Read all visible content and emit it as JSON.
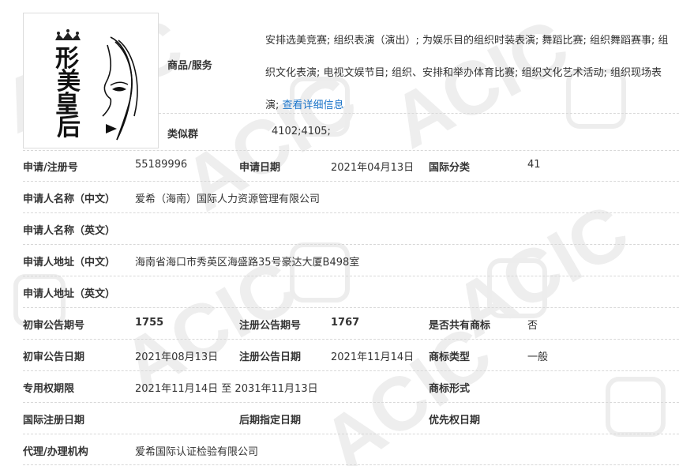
{
  "logo": {
    "text": "形美皇后",
    "chars": [
      "形",
      "美",
      "皇",
      "后"
    ],
    "icon": "crown-icon"
  },
  "goods": {
    "label": "商品/服务",
    "text": "安排选美竞赛; 组织表演（演出）; 为娱乐目的组织时装表演; 舞蹈比赛; 组织舞蹈赛事; 组织文化表演; 电视文娱节目; 组织、安排和举办体育比赛; 组织文化艺术活动; 组织现场表演;",
    "link": "查看详细信息"
  },
  "similar": {
    "label": "类似群",
    "value": "4102;4105;"
  },
  "row1": {
    "reg_no_label": "申请/注册号",
    "reg_no": "55189996",
    "app_date_label": "申请日期",
    "app_date": "2021年04月13日",
    "intl_class_label": "国际分类",
    "intl_class": "41"
  },
  "applicant_cn": {
    "label": "申请人名称（中文）",
    "value": "爱希（海南）国际人力资源管理有限公司"
  },
  "applicant_en": {
    "label": "申请人名称（英文）",
    "value": ""
  },
  "address_cn": {
    "label": "申请人地址（中文）",
    "value": "海南省海口市秀英区海盛路35号豪达大厦B498室"
  },
  "address_en": {
    "label": "申请人地址（英文）",
    "value": ""
  },
  "row_pub": {
    "prelim_no_label": "初审公告期号",
    "prelim_no": "1755",
    "reg_pub_no_label": "注册公告期号",
    "reg_pub_no": "1767",
    "shared_label": "是否共有商标",
    "shared": "否"
  },
  "row_pub_date": {
    "prelim_date_label": "初审公告日期",
    "prelim_date": "2021年08月13日",
    "reg_pub_date_label": "注册公告日期",
    "reg_pub_date": "2021年11月14日",
    "type_label": "商标类型",
    "type": "一般"
  },
  "row_term": {
    "term_label": "专用权期限",
    "term": "2021年11月14日 至 2031年11月13日",
    "form_label": "商标形式",
    "form": ""
  },
  "row_intl": {
    "intl_reg_label": "国际注册日期",
    "intl_reg": "",
    "later_label": "后期指定日期",
    "later": "",
    "priority_label": "优先权日期",
    "priority": ""
  },
  "agent": {
    "label": "代理/办理机构",
    "value": "爱希国际认证检验有限公司"
  },
  "watermark": {
    "text": "ACIC",
    "color": "#ececec"
  }
}
